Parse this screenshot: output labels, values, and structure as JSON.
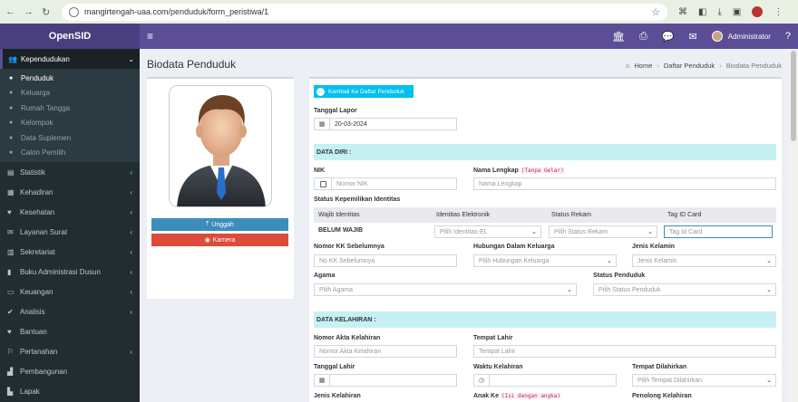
{
  "browser": {
    "url": "mangirtengah-uaa.com/penduduk/form_peristiwa/1"
  },
  "brand": "OpenSID",
  "topbar": {
    "user_name": "Administrator"
  },
  "sidebar": {
    "active_group": "Kependudukan",
    "sub_items": [
      {
        "label": "Penduduk",
        "icon": "user-icon"
      },
      {
        "label": "Keluarga",
        "icon": "users-icon"
      },
      {
        "label": "Rumah Tangga",
        "icon": "users-icon"
      },
      {
        "label": "Kelompok",
        "icon": "sitemap-icon"
      },
      {
        "label": "Data Suplemen",
        "icon": "users-icon"
      },
      {
        "label": "Calon Pemilih",
        "icon": "people-icon"
      }
    ],
    "menu": [
      {
        "label": "Statistik",
        "icon": "chart-icon"
      },
      {
        "label": "Kehadiran",
        "icon": "calendar-icon"
      },
      {
        "label": "Kesehatan",
        "icon": "heart-icon"
      },
      {
        "label": "Layanan Surat",
        "icon": "envelope-icon"
      },
      {
        "label": "Sekretariat",
        "icon": "archive-icon"
      },
      {
        "label": "Buku Administrasi Dusun",
        "icon": "book-icon"
      },
      {
        "label": "Keuangan",
        "icon": "money-icon"
      },
      {
        "label": "Analisis",
        "icon": "check-icon"
      },
      {
        "label": "Bantuan",
        "icon": "heart-icon"
      },
      {
        "label": "Pertanahan",
        "icon": "map-icon"
      },
      {
        "label": "Pembangunan",
        "icon": "building-icon"
      },
      {
        "label": "Lapak",
        "icon": "store-icon"
      }
    ]
  },
  "page": {
    "title": "Biodata Penduduk",
    "breadcrumb": {
      "home": "Home",
      "list": "Daftar Penduduk",
      "current": "Biodata Penduduk"
    }
  },
  "photo": {
    "upload_label": "Unggah",
    "camera_label": "Kamera"
  },
  "form": {
    "back_button": "Kembali Ke Daftar Penduduk",
    "tanggal_lapor": {
      "label": "Tanggal Lapor",
      "value": "20-03-2024"
    },
    "section_data_diri": "DATA DIRI :",
    "nik": {
      "label": "NIK",
      "placeholder": "Nomor NIK"
    },
    "nama": {
      "label": "Nama Lengkap",
      "hint": "(Tanpa Gelar)",
      "placeholder": "Nama Lengkap"
    },
    "status_kepemilikan_label": "Status Kepemilikan Identitas",
    "table_headers": [
      "Wajib Identitas",
      "Identitas Elektronik",
      "Status Rekam",
      "Tag ID Card"
    ],
    "table_row": {
      "wajib": "BELUM WAJIB",
      "identitas_placeholder": "Pilih Identitas-EL",
      "rekam_placeholder": "Pilih Status Rekam",
      "tag_placeholder": "Tag Id Card"
    },
    "nomor_kk": {
      "label": "Nomor KK Sebelumnya",
      "placeholder": "No KK Sebelumnya"
    },
    "hubungan": {
      "label": "Hubungan Dalam Keluarga",
      "placeholder": "Pilih Hubungan Keluarga"
    },
    "jenis_kelamin": {
      "label": "Jenis Kelamin",
      "placeholder": "Jenis Kelamin"
    },
    "agama": {
      "label": "Agama",
      "placeholder": "Pilih Agama"
    },
    "status_penduduk": {
      "label": "Status Penduduk",
      "placeholder": "Pilih Status Penduduk"
    },
    "section_kelahiran": "DATA KELAHIRAN :",
    "akta": {
      "label": "Nomor Akta Kelahiran",
      "placeholder": "Nomor Akta Kelahiran"
    },
    "tempat_lahir": {
      "label": "Tempat Lahir",
      "placeholder": "Tempat Lahir"
    },
    "tanggal_lahir": {
      "label": "Tanggal Lahir"
    },
    "waktu_kelahiran": {
      "label": "Waktu Kelahiran"
    },
    "tempat_dilahirkan": {
      "label": "Tempat Dilahirkan",
      "placeholder": "Pilih Tempat Dilahirkan"
    },
    "jenis_kelahiran": {
      "label": "Jenis Kelahiran"
    },
    "anak_ke": {
      "label": "Anak Ke",
      "hint": "(Isi dengan angka)"
    },
    "penolong": {
      "label": "Penolong Kelahiran"
    }
  }
}
